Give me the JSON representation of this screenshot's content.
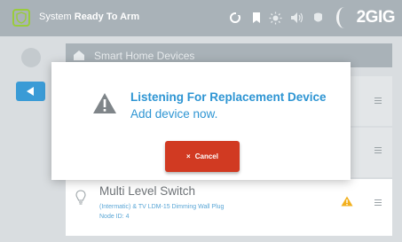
{
  "status_bar": {
    "system_prefix": "System",
    "system_state": "Ready To Arm",
    "brand": "2GIG",
    "icons": [
      "refresh-icon",
      "bookmark-icon",
      "brightness-icon",
      "volume-icon",
      "settings-icon"
    ]
  },
  "background_screen": {
    "header_title": "Smart Home Devices",
    "device_row": {
      "title": "Multi Level Switch",
      "subtitle_line1": "(Intermatic) & TV LDM-15 Dimming Wall Plug",
      "subtitle_line2": "Node ID: 4"
    }
  },
  "modal": {
    "title": "Listening For Replacement Device",
    "message": "Add device now.",
    "cancel_label": "Cancel",
    "cancel_icon": "×"
  },
  "colors": {
    "accent_blue": "#2e95d3",
    "cancel_red": "#d13a22",
    "armed_green": "#9acc3c",
    "warning_yellow": "#f2b01e"
  }
}
